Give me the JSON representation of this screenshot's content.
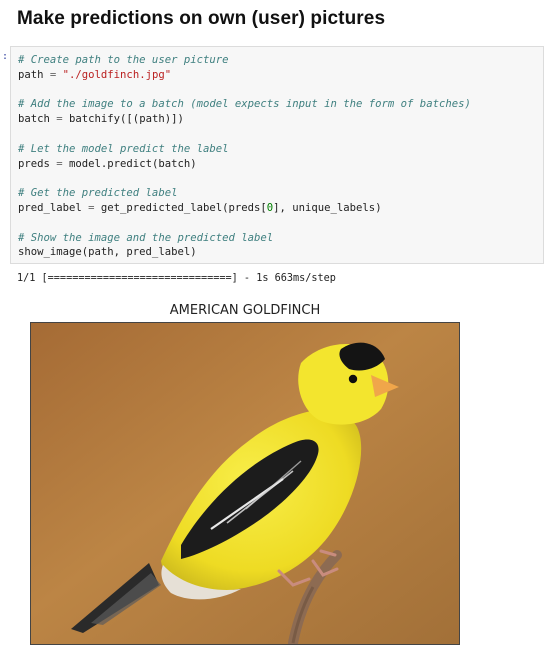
{
  "page": {
    "heading": "Make predictions on own (user) pictures"
  },
  "cell": {
    "prompt": ":",
    "lines": [
      {
        "type": "comment",
        "text": "# Create path to the user picture"
      },
      {
        "type": "code",
        "parts": [
          [
            "path",
            "n"
          ],
          [
            " = ",
            "o"
          ],
          [
            "\"./goldfinch.jpg\"",
            "s"
          ]
        ]
      },
      {
        "type": "blank"
      },
      {
        "type": "comment",
        "text": "# Add the image to a batch (model expects input in the form of batches)"
      },
      {
        "type": "code",
        "parts": [
          [
            "batch",
            "n"
          ],
          [
            " = ",
            "o"
          ],
          [
            "batchify([(path)])",
            "n"
          ]
        ]
      },
      {
        "type": "blank"
      },
      {
        "type": "comment",
        "text": "# Let the model predict the label"
      },
      {
        "type": "code",
        "parts": [
          [
            "preds",
            "n"
          ],
          [
            " = ",
            "o"
          ],
          [
            "model.predict(batch)",
            "n"
          ]
        ]
      },
      {
        "type": "blank"
      },
      {
        "type": "comment",
        "text": "# Get the predicted label"
      },
      {
        "type": "code",
        "parts": [
          [
            "pred_label",
            "n"
          ],
          [
            " = ",
            "o"
          ],
          [
            "get_predicted_label(preds[",
            "n"
          ],
          [
            "0",
            "g"
          ],
          [
            "], unique_labels)",
            "n"
          ]
        ]
      },
      {
        "type": "blank"
      },
      {
        "type": "comment",
        "text": "# Show the image and the predicted label"
      },
      {
        "type": "code",
        "parts": [
          [
            "show_image(path, pred_label)",
            "n"
          ]
        ]
      }
    ]
  },
  "output": {
    "progress_text": "1/1 [==============================] - 1s 663ms/step"
  },
  "figure": {
    "title": "AMERICAN GOLDFINCH",
    "image_subject": "goldfinch-photo",
    "colors": {
      "background": "#b77a3a",
      "body_yellow": "#f1e22c",
      "wing_black": "#1c1c1c",
      "beak_orange": "#f0a64a",
      "branch": "#8d6b52"
    }
  }
}
